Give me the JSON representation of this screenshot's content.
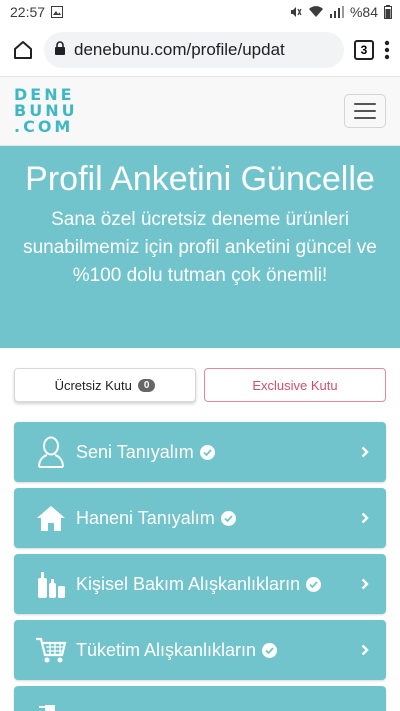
{
  "status_bar": {
    "time": "22:57",
    "battery": "%84"
  },
  "browser": {
    "url": "denebunu.com/profile/updat",
    "tab_count": "3"
  },
  "site": {
    "logo": [
      "DENE",
      "BUNU",
      ".COM"
    ]
  },
  "hero": {
    "title": "Profil Anketini Güncelle",
    "subtitle": "Sana özel ücretsiz deneme ürünleri sunabilmemiz için profil anketini güncel ve %100 dolu tutman çok önemli!"
  },
  "tabs": {
    "free_label": "Ücretsiz Kutu",
    "free_count": "0",
    "exclusive_label": "Exclusive Kutu"
  },
  "surveys": [
    {
      "label": "Seni Tanıyalım",
      "icon": "person-icon"
    },
    {
      "label": "Haneni Tanıyalım",
      "icon": "home-icon"
    },
    {
      "label": "Kişisel Bakım Alışkanlıkların",
      "icon": "bottles-icon"
    },
    {
      "label": "Tüketim Alışkanlıkların",
      "icon": "cart-icon"
    }
  ],
  "colors": {
    "brand": "#3fb8c5",
    "hero_bg": "#72c4cc",
    "exclusive": "#d0506b"
  }
}
